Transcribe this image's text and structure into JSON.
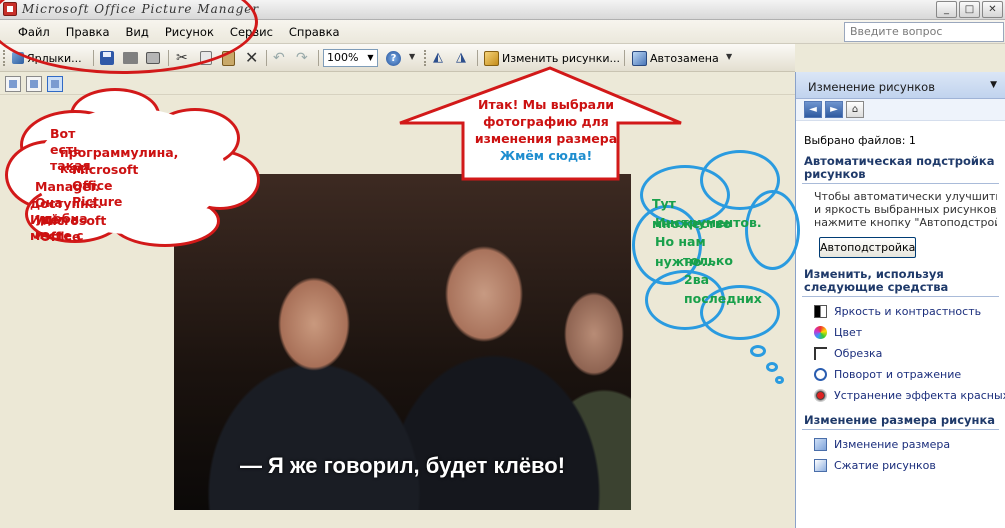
{
  "window": {
    "title": "Microsoft Office Picture Manager",
    "controls": [
      "_",
      "□",
      "✕"
    ]
  },
  "menu": {
    "items": [
      "Файл",
      "Правка",
      "Вид",
      "Рисунок",
      "Сервис",
      "Справка"
    ],
    "ask_placeholder": "Введите вопрос"
  },
  "toolbar": {
    "shortcuts_label": "Ярлыки...",
    "zoom_value": "100%",
    "edit_label": "Изменить рисунки...",
    "autocorrect_label": "Автозамена"
  },
  "photo": {
    "caption": "— Я же говорил, будет клёво!"
  },
  "pane": {
    "header": "Изменение рисунков",
    "files_selected": "Выбрано файлов: 1",
    "section1_title": "Автоматическая подстройка рисунков",
    "section1_desc": [
      "Чтобы автоматически улучшить цвет",
      "и яркость выбранных рисунков,",
      "нажмите кнопку \"Автоподстройка\"."
    ],
    "auto_button": "Автоподстройка",
    "section2_title": "Изменить, используя следующие средства",
    "section2_links": [
      "Яркость и контрастность",
      "Цвет",
      "Обрезка",
      "Поворот и отражение",
      "Устранение эффекта красных глаз"
    ],
    "section3_title": "Изменение размера рисунка",
    "section3_links": [
      "Изменение размера",
      "Сжатие рисунков"
    ]
  },
  "annotations": {
    "left_cloud": [
      "Вот есть такая",
      "программулина, как",
      "Microsoft Office Picture",
      "Manager. Она удобна и",
      "доступна. Идёт в месте с",
      "Microsoft Office"
    ],
    "arrow_text": [
      "Итак! Мы выбрали",
      "фотографию для",
      "изменения размера"
    ],
    "arrow_text_blue": "Жмём сюда!",
    "right_cloud": [
      "Тут множество",
      "Инструментов.",
      "Но нам нужно...",
      "только",
      "2ва",
      "последних"
    ],
    "colors": {
      "red": "#d21919",
      "blue": "#2a9be0",
      "green": "#19a04b"
    }
  }
}
